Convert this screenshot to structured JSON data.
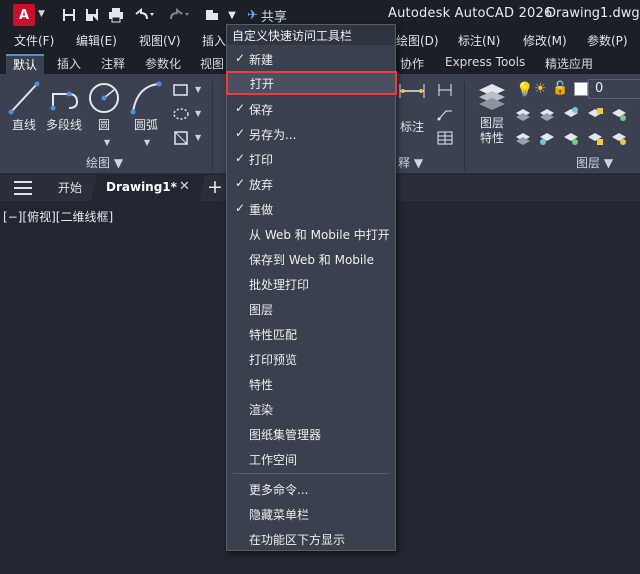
{
  "titlebar": {
    "app_logo_letter": "A",
    "share_label": "共享",
    "app_title": "Autodesk AutoCAD 2026",
    "document_name": "Drawing1.dwg"
  },
  "menubar": {
    "items": [
      "文件(F)",
      "编辑(E)",
      "视图(V)",
      "插入",
      "绘图(D)",
      "标注(N)",
      "修改(M)",
      "参数(P)"
    ]
  },
  "ribbon_tabs": {
    "items": [
      "默认",
      "插入",
      "注释",
      "参数化",
      "视图",
      "协作",
      "Express Tools",
      "精选应用"
    ],
    "active_index": 0
  },
  "ribbon": {
    "draw_tools": [
      "直线",
      "多段线",
      "圆",
      "圆弧"
    ],
    "draw_group_label": "绘图",
    "annotation_tool": "标注",
    "annotation_group_partial": "释",
    "layer_tool_line1": "图层",
    "layer_tool_line2": "特性",
    "layer_group_label": "图层",
    "layer_value": "0"
  },
  "file_tabs": {
    "start_label": "开始",
    "active_label": "Drawing1*"
  },
  "viewport": {
    "label": "[−][俯视][二维线框]"
  },
  "dropdown": {
    "header": "自定义快速访问工具栏",
    "items": [
      {
        "label": "新建",
        "checked": true
      },
      {
        "label": "打开",
        "checked": false,
        "highlighted": true
      },
      {
        "label": "保存",
        "checked": true
      },
      {
        "label": "另存为...",
        "checked": true
      },
      {
        "label": "打印",
        "checked": true
      },
      {
        "label": "放弃",
        "checked": true
      },
      {
        "label": "重做",
        "checked": true
      },
      {
        "label": "从 Web 和 Mobile 中打开",
        "checked": false
      },
      {
        "label": "保存到 Web 和 Mobile",
        "checked": false
      },
      {
        "label": "批处理打印",
        "checked": false
      },
      {
        "label": "图层",
        "checked": false
      },
      {
        "label": "特性匹配",
        "checked": false
      },
      {
        "label": "打印预览",
        "checked": false
      },
      {
        "label": "特性",
        "checked": false
      },
      {
        "label": "渲染",
        "checked": false
      },
      {
        "label": "图纸集管理器",
        "checked": false
      },
      {
        "label": "工作空间",
        "checked": false
      }
    ],
    "extra_items": [
      "更多命令...",
      "隐藏菜单栏",
      "在功能区下方显示"
    ]
  },
  "colors": {
    "logo_red": "#c8102e",
    "highlight_border": "#e34040",
    "accent_blue": "#4a90e2"
  }
}
